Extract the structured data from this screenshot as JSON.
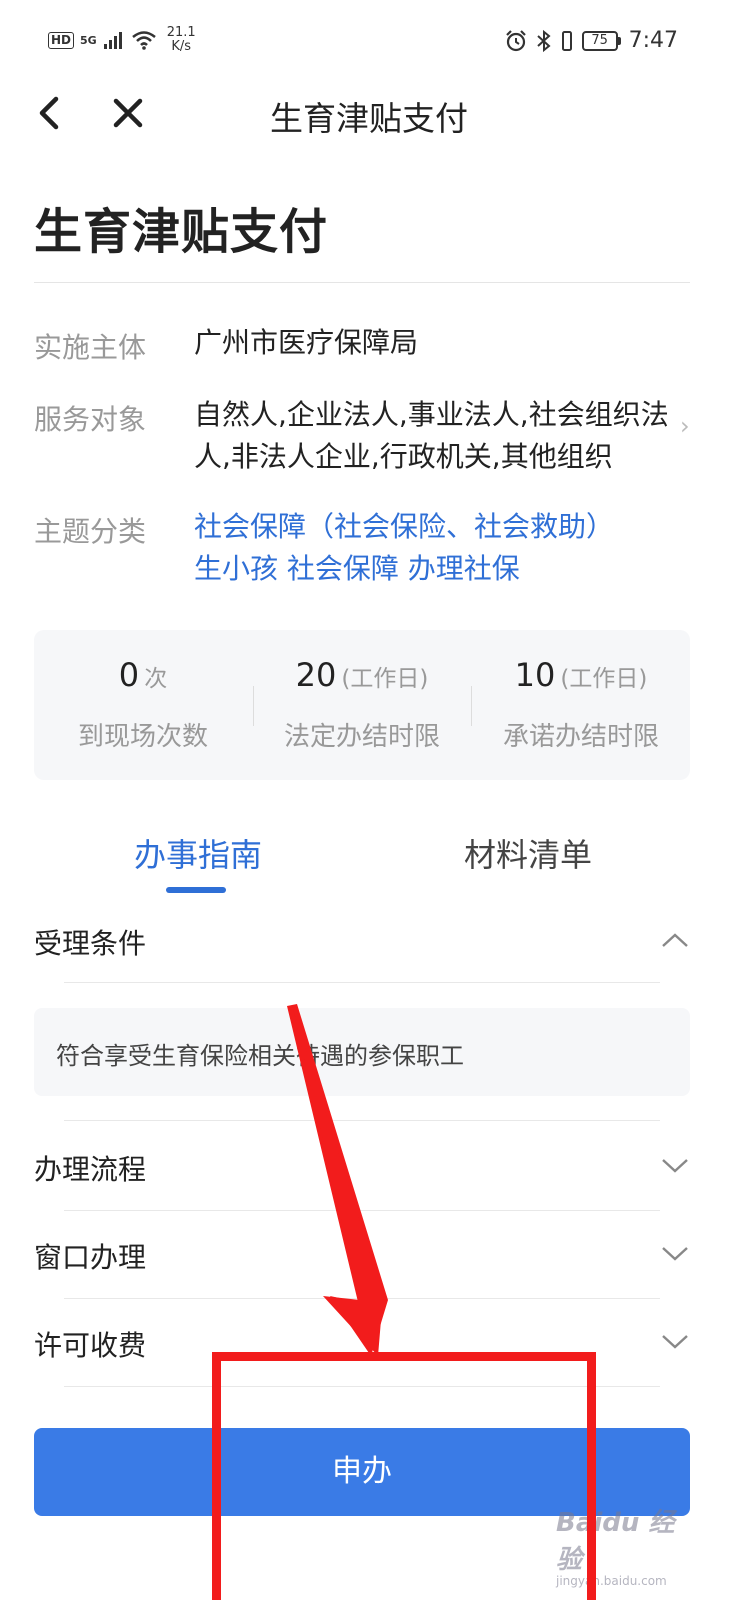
{
  "status_bar": {
    "hd": "HD",
    "signal": "5G",
    "net_speed_value": "21.1",
    "net_speed_unit": "K/s",
    "battery": "75",
    "time": "7:47"
  },
  "nav": {
    "title": "生育津贴支付"
  },
  "page": {
    "title": "生育津贴支付"
  },
  "info": {
    "implementer_label": "实施主体",
    "implementer_value": "广州市医疗保障局",
    "audience_label": "服务对象",
    "audience_value": "自然人,企业法人,事业法人,社会组织法人,非法人企业,行政机关,其他组织",
    "topic_label": "主题分类",
    "topic_line1": "社会保障（社会保险、社会救助）",
    "topic_line2": "生小孩 社会保障 办理社保"
  },
  "stats": [
    {
      "value": "0",
      "unit": "次",
      "label": "到现场次数"
    },
    {
      "value": "20",
      "unit": "(工作日)",
      "label": "法定办结时限"
    },
    {
      "value": "10",
      "unit": "(工作日)",
      "label": "承诺办结时限"
    }
  ],
  "tabs": [
    {
      "label": "办事指南",
      "active": true
    },
    {
      "label": "材料清单",
      "active": false
    }
  ],
  "sections": {
    "conditions": {
      "title": "受理条件",
      "content": "符合享受生育保险相关待遇的参保职工",
      "expanded": true
    },
    "process": {
      "title": "办理流程",
      "expanded": false
    },
    "window": {
      "title": "窗口办理",
      "expanded": false
    },
    "fee": {
      "title": "许可收费",
      "expanded": false
    }
  },
  "apply_button": {
    "label": "申办"
  },
  "watermark": {
    "logo": "Baidu 经验",
    "sub": "jingyan.baidu.com"
  },
  "colors": {
    "accent": "#2f6fd6",
    "button": "#3a7be6",
    "annotation": "#f21c1c"
  }
}
